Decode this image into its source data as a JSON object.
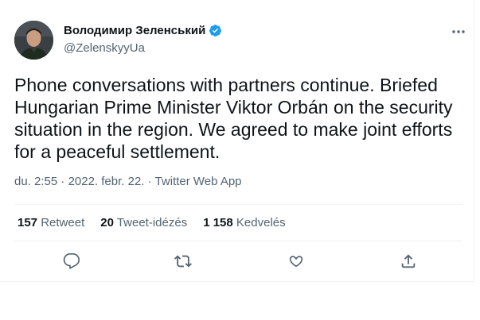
{
  "author": {
    "display_name": "Володимир Зеленський",
    "handle": "@ZelenskyyUa",
    "verified_icon": "verified-badge-icon",
    "brand_color": "#1d9bf0"
  },
  "tweet": {
    "text": "Phone conversations with partners continue. Briefed\nHungarian Prime Minister Viktor Orbán on the security\nsituation in the region. We agreed to make joint efforts\nfor a peaceful settlement.",
    "time": "du. 2:55",
    "dot1": "·",
    "date": "2022. febr. 22.",
    "dot2": "·",
    "source": "Twitter Web App"
  },
  "stats": {
    "retweets_count": "157",
    "retweets_label": "Retweet",
    "quotes_count": "20",
    "quotes_label": "Tweet-idézés",
    "likes_count": "1 158",
    "likes_label": "Kedvelés"
  },
  "actions": [
    "reply-icon",
    "retweet-icon",
    "like-icon",
    "share-icon"
  ],
  "colors": {
    "text_primary": "#0f1419",
    "text_secondary": "#536471",
    "divider": "#eff3f4"
  }
}
